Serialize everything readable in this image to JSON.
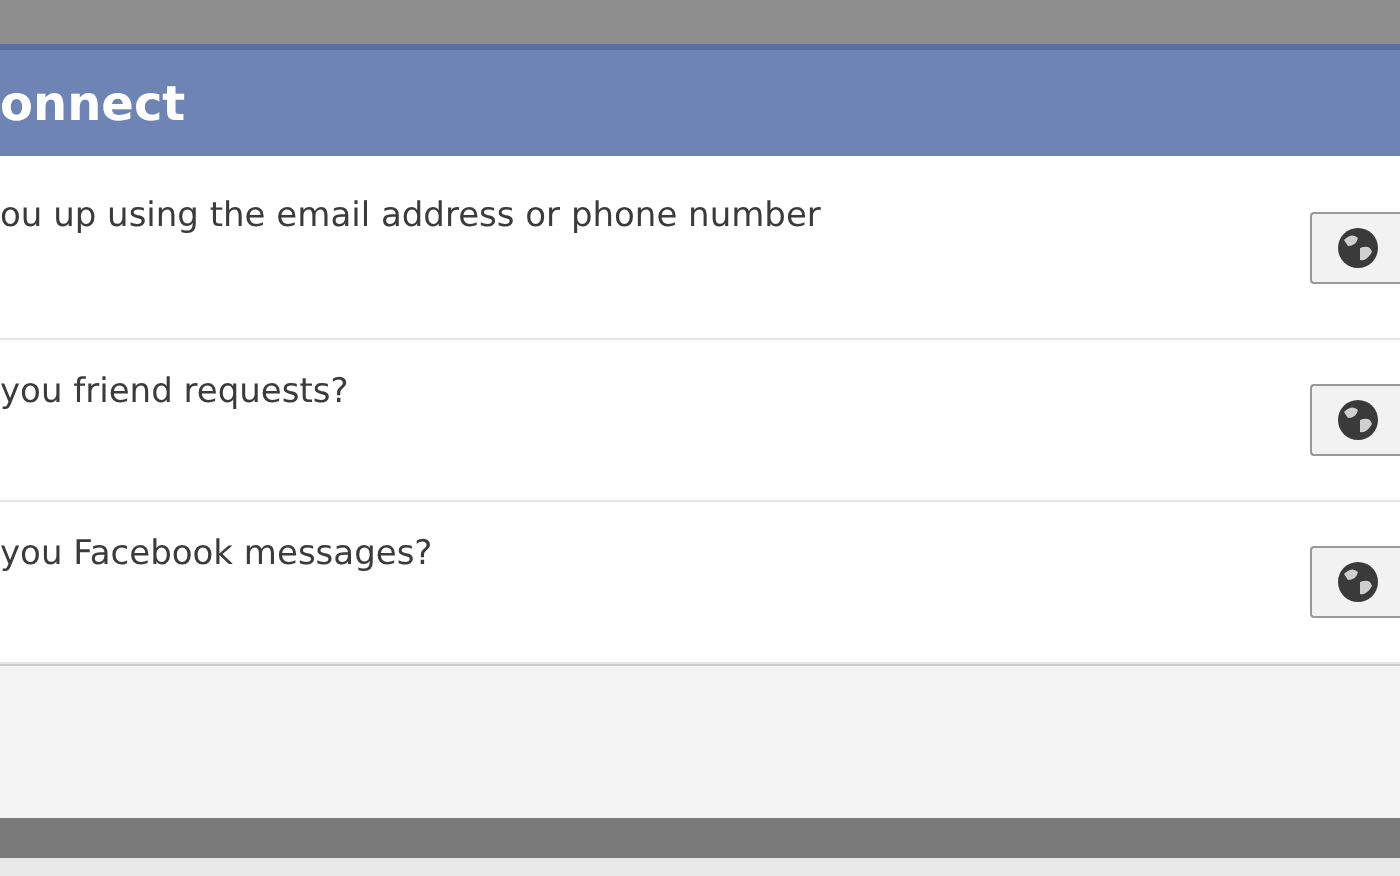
{
  "header": {
    "title": "onnect"
  },
  "settings": [
    {
      "question": "ou up using the email address or phone number"
    },
    {
      "question": "you friend requests?"
    },
    {
      "question": "you Facebook messages?"
    }
  ]
}
